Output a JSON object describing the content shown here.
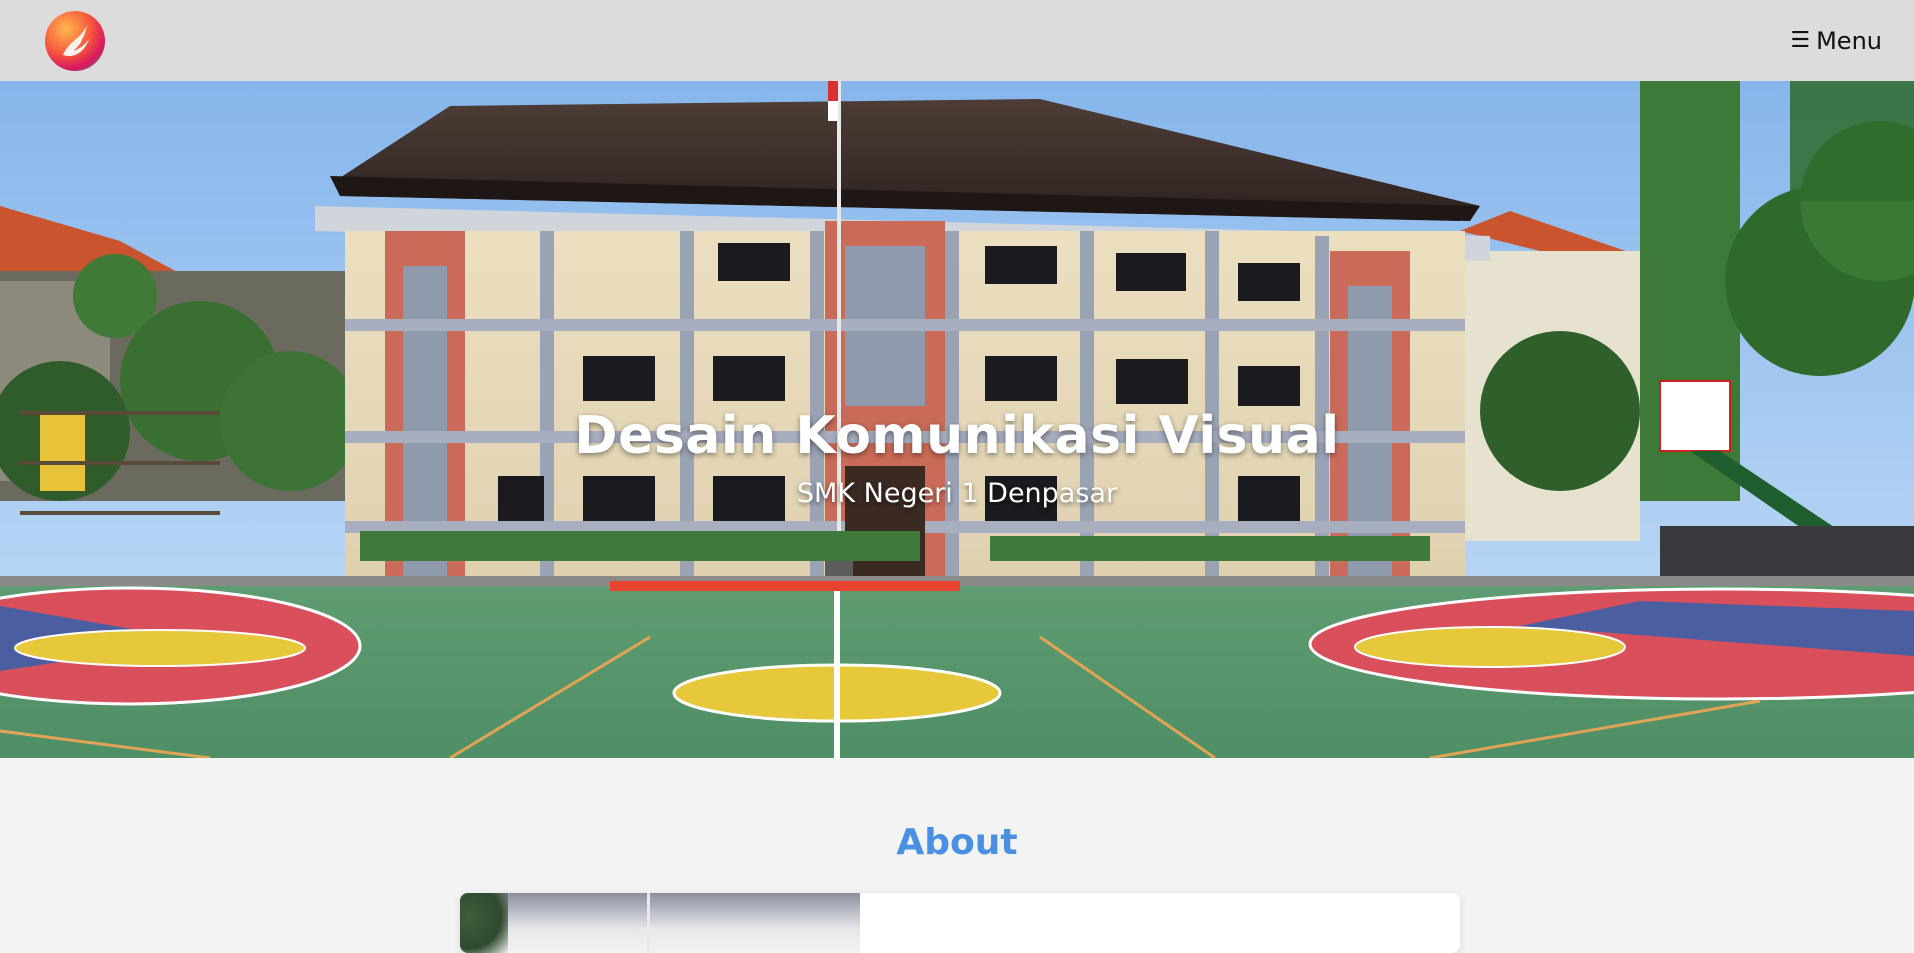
{
  "header": {
    "logo_icon": "phoenix-logo-icon",
    "menu_icon": "hamburger-icon",
    "menu_glyph": "☰",
    "menu_label": "Menu"
  },
  "hero": {
    "title": "Desain Komunikasi Visual",
    "subtitle": "SMK Negeri 1 Denpasar",
    "image_description_icon": "school-building-photo"
  },
  "about": {
    "title": "About"
  },
  "colors": {
    "header_bg": "#dcdcdc",
    "page_bg": "#f3f3f3",
    "about_title": "#4a90e2",
    "hero_text": "#ffffff"
  }
}
